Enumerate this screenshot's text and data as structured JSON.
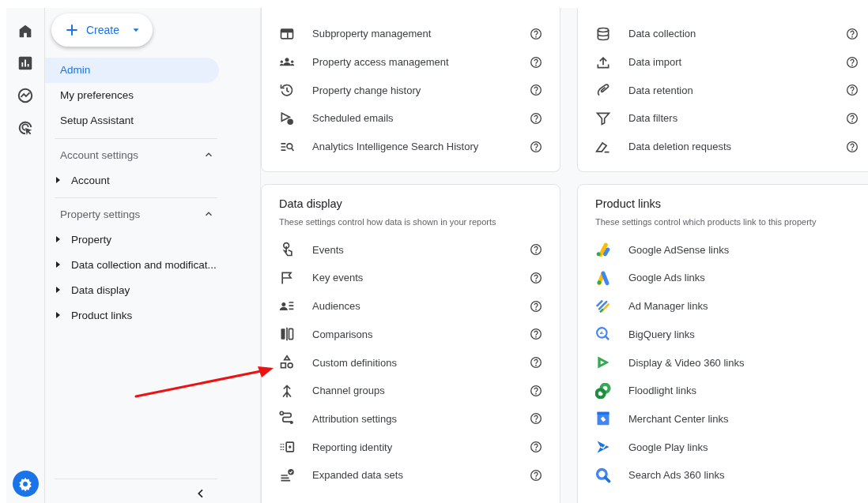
{
  "create_button": {
    "label": "Create"
  },
  "sidebar": {
    "items": [
      {
        "label": "Admin",
        "selected": true
      },
      {
        "label": "My preferences",
        "selected": false
      },
      {
        "label": "Setup Assistant",
        "selected": false
      }
    ],
    "sections": [
      {
        "title": "Account settings",
        "expanded": true,
        "items": [
          {
            "label": "Account",
            "expanded": false
          }
        ]
      },
      {
        "title": "Property settings",
        "expanded": true,
        "items": [
          {
            "label": "Property",
            "expanded": false
          },
          {
            "label": "Data collection and modificat...",
            "expanded": false
          },
          {
            "label": "Data display",
            "expanded": false
          },
          {
            "label": "Product links",
            "expanded": false
          }
        ]
      }
    ]
  },
  "cards": [
    {
      "kind": "settings",
      "help": true,
      "items": [
        "Subproperty management",
        "Property access management",
        "Property change history",
        "Scheduled emails",
        "Analytics Intelligence Search History"
      ]
    },
    {
      "kind": "settings",
      "help": true,
      "items": [
        "Data collection",
        "Data import",
        "Data retention",
        "Data filters",
        "Data deletion requests"
      ]
    },
    {
      "kind": "settings",
      "help": true,
      "title": "Data display",
      "subtitle": "These settings control how data is shown in your reports",
      "items": [
        "Events",
        "Key events",
        "Audiences",
        "Comparisons",
        "Custom definitions",
        "Channel groups",
        "Attribution settings",
        "Reporting identity",
        "Expanded data sets"
      ]
    },
    {
      "kind": "products",
      "help": false,
      "title": "Product links",
      "subtitle": "These settings control which products link to this property",
      "items": [
        "Google AdSense links",
        "Google Ads links",
        "Ad Manager links",
        "BigQuery links",
        "Display & Video 360 links",
        "Floodlight links",
        "Merchant Center links",
        "Google Play links",
        "Search Ads 360 links"
      ]
    }
  ]
}
